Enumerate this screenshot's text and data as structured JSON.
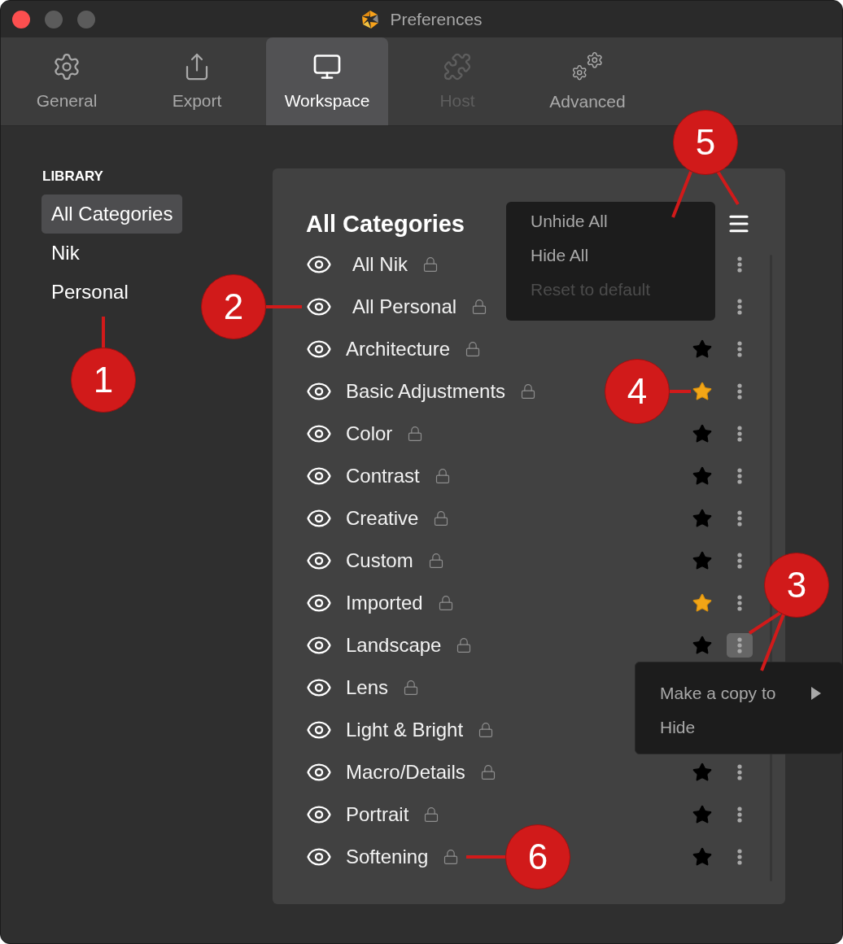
{
  "window": {
    "title": "Preferences"
  },
  "tabs": [
    {
      "label": "General",
      "kind": "gear",
      "selected": false,
      "disabled": false
    },
    {
      "label": "Export",
      "kind": "export",
      "selected": false,
      "disabled": false
    },
    {
      "label": "Workspace",
      "kind": "monitor",
      "selected": true,
      "disabled": false
    },
    {
      "label": "Host",
      "kind": "puzzle",
      "selected": false,
      "disabled": true
    },
    {
      "label": "Advanced",
      "kind": "gears",
      "selected": false,
      "disabled": false
    }
  ],
  "sidebar": {
    "heading": "LIBRARY",
    "items": [
      {
        "label": "All Categories",
        "selected": true
      },
      {
        "label": "Nik",
        "selected": false
      },
      {
        "label": "Personal",
        "selected": false
      }
    ]
  },
  "panel": {
    "title": "All Categories",
    "rows": [
      {
        "label": "All Nik",
        "kind": "group",
        "active": false
      },
      {
        "label": "All Personal",
        "kind": "group",
        "active": false
      },
      {
        "label": "Architecture",
        "kind": "category",
        "starred": false,
        "active": false
      },
      {
        "label": "Basic Adjustments",
        "kind": "category",
        "starred": true,
        "active": false
      },
      {
        "label": "Color",
        "kind": "category",
        "starred": false,
        "active": false
      },
      {
        "label": "Contrast",
        "kind": "category",
        "starred": false,
        "active": false
      },
      {
        "label": "Creative",
        "kind": "category",
        "starred": false,
        "active": false
      },
      {
        "label": "Custom",
        "kind": "category",
        "starred": false,
        "active": false
      },
      {
        "label": "Imported",
        "kind": "category",
        "starred": true,
        "active": false
      },
      {
        "label": "Landscape",
        "kind": "category",
        "starred": false,
        "active": true
      },
      {
        "label": "Lens",
        "kind": "category"
      },
      {
        "label": "Light & Bright",
        "kind": "category"
      },
      {
        "label": "Macro/Details",
        "kind": "category",
        "starred": false,
        "active": false
      },
      {
        "label": "Portrait",
        "kind": "category",
        "starred": false,
        "active": false
      },
      {
        "label": "Softening",
        "kind": "category",
        "starred": false,
        "active": false
      }
    ]
  },
  "header_menu": {
    "items": [
      {
        "label": "Unhide All",
        "disabled": false
      },
      {
        "label": "Hide All",
        "disabled": false
      },
      {
        "label": "Reset to default",
        "disabled": true
      }
    ]
  },
  "context_menu": {
    "items": [
      {
        "label": "Make a copy to",
        "submenu": true
      },
      {
        "label": "Hide",
        "submenu": false
      }
    ]
  },
  "callouts": [
    {
      "label": "1"
    },
    {
      "label": "2"
    },
    {
      "label": "3"
    },
    {
      "label": "4"
    },
    {
      "label": "5"
    },
    {
      "label": "6"
    }
  ]
}
